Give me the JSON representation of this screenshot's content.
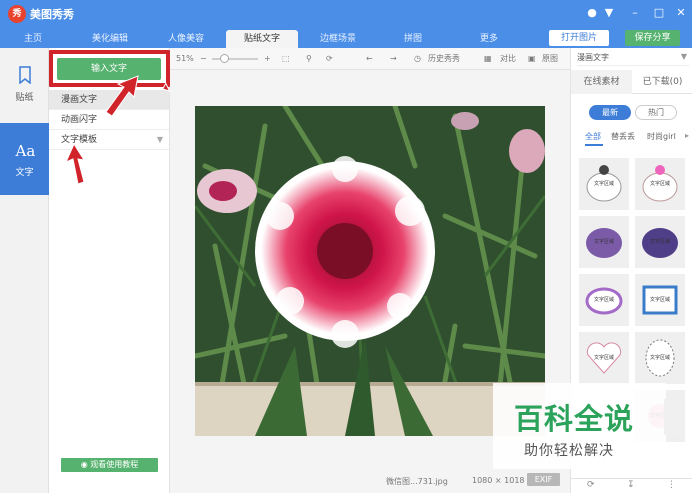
{
  "app": {
    "title": "美图秀秀",
    "logo_char": "秀"
  },
  "tabs": [
    "主页",
    "美化编辑",
    "人像美容",
    "贴纸文字",
    "边框场景",
    "拼图",
    "更多"
  ],
  "header_buttons": {
    "open": "打开图片",
    "save": "保存分享"
  },
  "left_nav": [
    {
      "label": "贴纸",
      "icon": "bookmark-icon"
    },
    {
      "label": "文字",
      "icon": "text-aa-icon"
    }
  ],
  "sub_panel": {
    "input_text_button": "输入文字",
    "items": [
      "漫画文字",
      "动画闪字",
      "文字模板"
    ],
    "tutorial_button": "观看使用教程"
  },
  "toolbar": {
    "zoom": "51%",
    "history": "历史秀秀",
    "contrast": "对比",
    "original": "原图"
  },
  "status": {
    "filename": "微信图...731.jpg",
    "dimensions": "1080 × 1018",
    "exif": "EXIF"
  },
  "right_panel": {
    "dropdown": "漫画文字",
    "tabs": [
      "在线素材",
      "已下载(0)"
    ],
    "pills": [
      "最新",
      "热门"
    ],
    "categories": [
      "全部",
      "替丢丢",
      "时尚girl"
    ],
    "thumb_label": "文字区域"
  },
  "watermark": {
    "line1": "百科全说",
    "line2": "助你轻松解决"
  },
  "colors": {
    "titlebar": "#4a8ee8",
    "accent": "#3d7dd8",
    "green": "#56b26f",
    "highlight": "#d0232a"
  }
}
